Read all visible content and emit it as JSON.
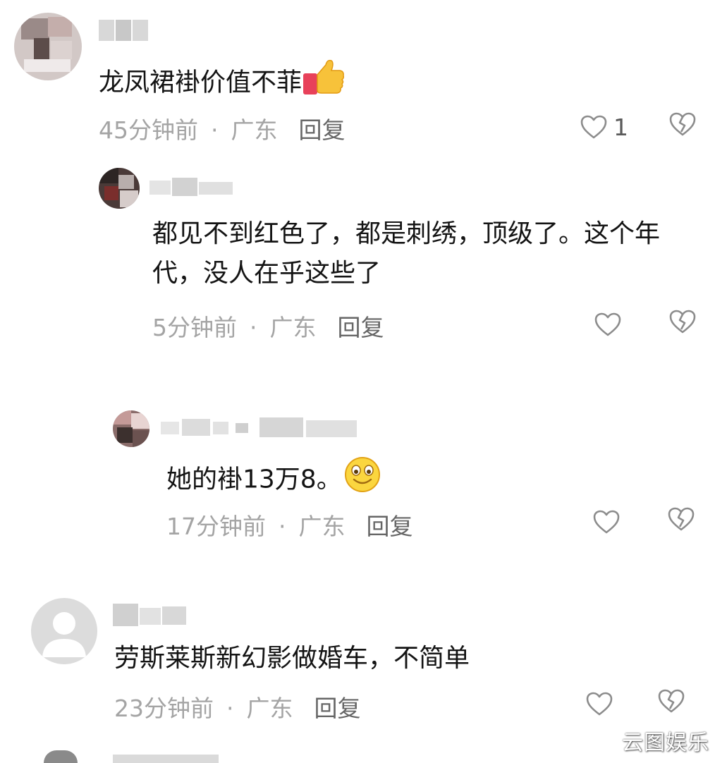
{
  "comments": [
    {
      "text": "龙凤裙褂价值不菲",
      "emoji": "thumbs-up",
      "time": "45分钟前",
      "location": "广东",
      "separator": "·",
      "reply_label": "回复",
      "like_count": "1"
    },
    {
      "text_line1": "都见不到红色了，都是刺绣，顶级了。这个年",
      "text_line2": "代，没人在乎这些了",
      "time": "5分钟前",
      "location": "广东",
      "separator": "·",
      "reply_label": "回复"
    },
    {
      "text": "她的褂13万8。",
      "emoji": "smiley",
      "time": "17分钟前",
      "location": "广东",
      "separator": "·",
      "reply_label": "回复"
    },
    {
      "text": "劳斯莱斯新幻影做婚车，不简单",
      "time": "23分钟前",
      "location": "广东",
      "separator": "·",
      "reply_label": "回复"
    }
  ],
  "icons": {
    "like": "heart-outline-icon",
    "dislike": "broken-heart-icon",
    "thumbs_up": "thumbs-up-emoji-icon",
    "smiley": "smiley-emoji-icon"
  },
  "colors": {
    "text": "#141414",
    "meta": "#a4a4a4",
    "reply": "#666666",
    "icon": "#8c8c8c"
  },
  "watermark": "云图娱乐"
}
